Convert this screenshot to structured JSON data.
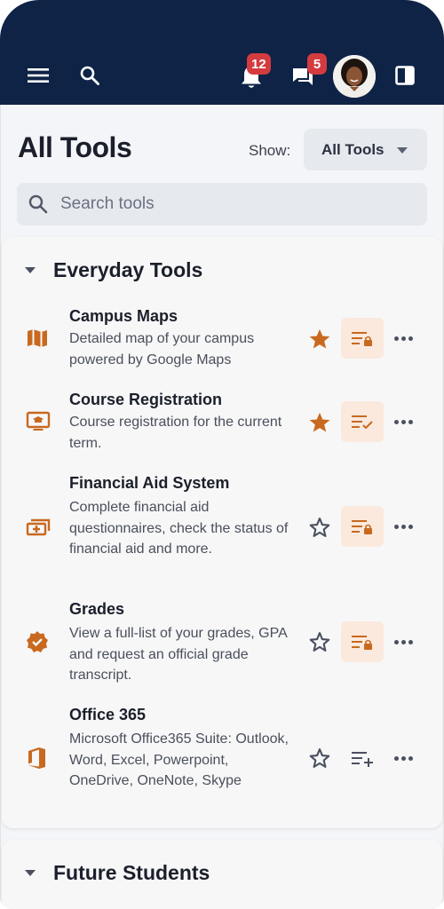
{
  "topbar": {
    "notifications_count": "12",
    "messages_count": "5",
    "icons": [
      "menu-icon",
      "search-icon",
      "bell-icon",
      "chat-icon",
      "avatar",
      "side-panel-icon"
    ]
  },
  "page": {
    "title": "All Tools",
    "show_label": "Show:",
    "show_value": "All Tools",
    "search_placeholder": "Search tools"
  },
  "sections": [
    {
      "title": "Everyday Tools",
      "tools": [
        {
          "title": "Campus Maps",
          "desc": "Detailed map of your campus powered by Google Maps",
          "favorite": true,
          "list_state": "locked",
          "icon": "map-icon"
        },
        {
          "title": "Course Registration",
          "desc": "Course registration for the current term.",
          "favorite": true,
          "list_state": "added",
          "icon": "laptop-icon"
        },
        {
          "title": "Financial Aid System",
          "desc": "Complete financial aid questionnaires, check the status of financial aid and more.",
          "favorite": false,
          "list_state": "locked",
          "icon": "money-icon"
        },
        {
          "title": "Grades",
          "desc": "View a full-list of your grades, GPA and request an official grade transcript.",
          "favorite": false,
          "list_state": "locked",
          "icon": "verified-badge-icon"
        },
        {
          "title": "Office 365",
          "desc": "Microsoft Office365 Suite: Outlook, Word, Excel, Powerpoint, OneDrive, OneNote, Skype",
          "favorite": false,
          "list_state": "add",
          "icon": "office-icon"
        }
      ]
    },
    {
      "title": "Future Students",
      "tools": []
    }
  ],
  "colors": {
    "topbar": "#0e2346",
    "accent": "#c8691f",
    "badge": "#d43b3f",
    "list_bg": "#fbe9dd"
  }
}
